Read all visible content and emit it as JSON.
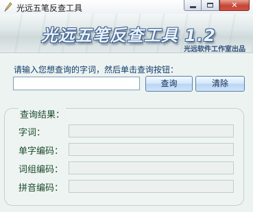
{
  "window": {
    "title": "光远五笔反查工具",
    "controls": {
      "minimize": "minimize",
      "maximize": "maximize",
      "close": "close"
    }
  },
  "banner": {
    "title": "光远五笔反查工具 1.2",
    "subtitle": "光远软件工作室出品"
  },
  "search": {
    "prompt": "请输入您想查询的字词，然后单击查询按钮：",
    "input_value": "",
    "query_button": "查询",
    "clear_button": "清除"
  },
  "results": {
    "title": "查询结果：",
    "fields": [
      {
        "label": "字词：",
        "value": ""
      },
      {
        "label": "单字编码：",
        "value": ""
      },
      {
        "label": "词组编码：",
        "value": ""
      },
      {
        "label": "拼音编码：",
        "value": ""
      }
    ]
  },
  "icons": {
    "app": "pen-icon",
    "minimize": "minimize-icon",
    "maximize": "maximize-icon",
    "close": "close-icon"
  },
  "colors": {
    "banner_text": "#e8f3ff",
    "banner_outline": "#3b5b86",
    "label_text": "#1b4a2b",
    "prompt_text": "#123a6a",
    "close_button": "#c74535"
  }
}
